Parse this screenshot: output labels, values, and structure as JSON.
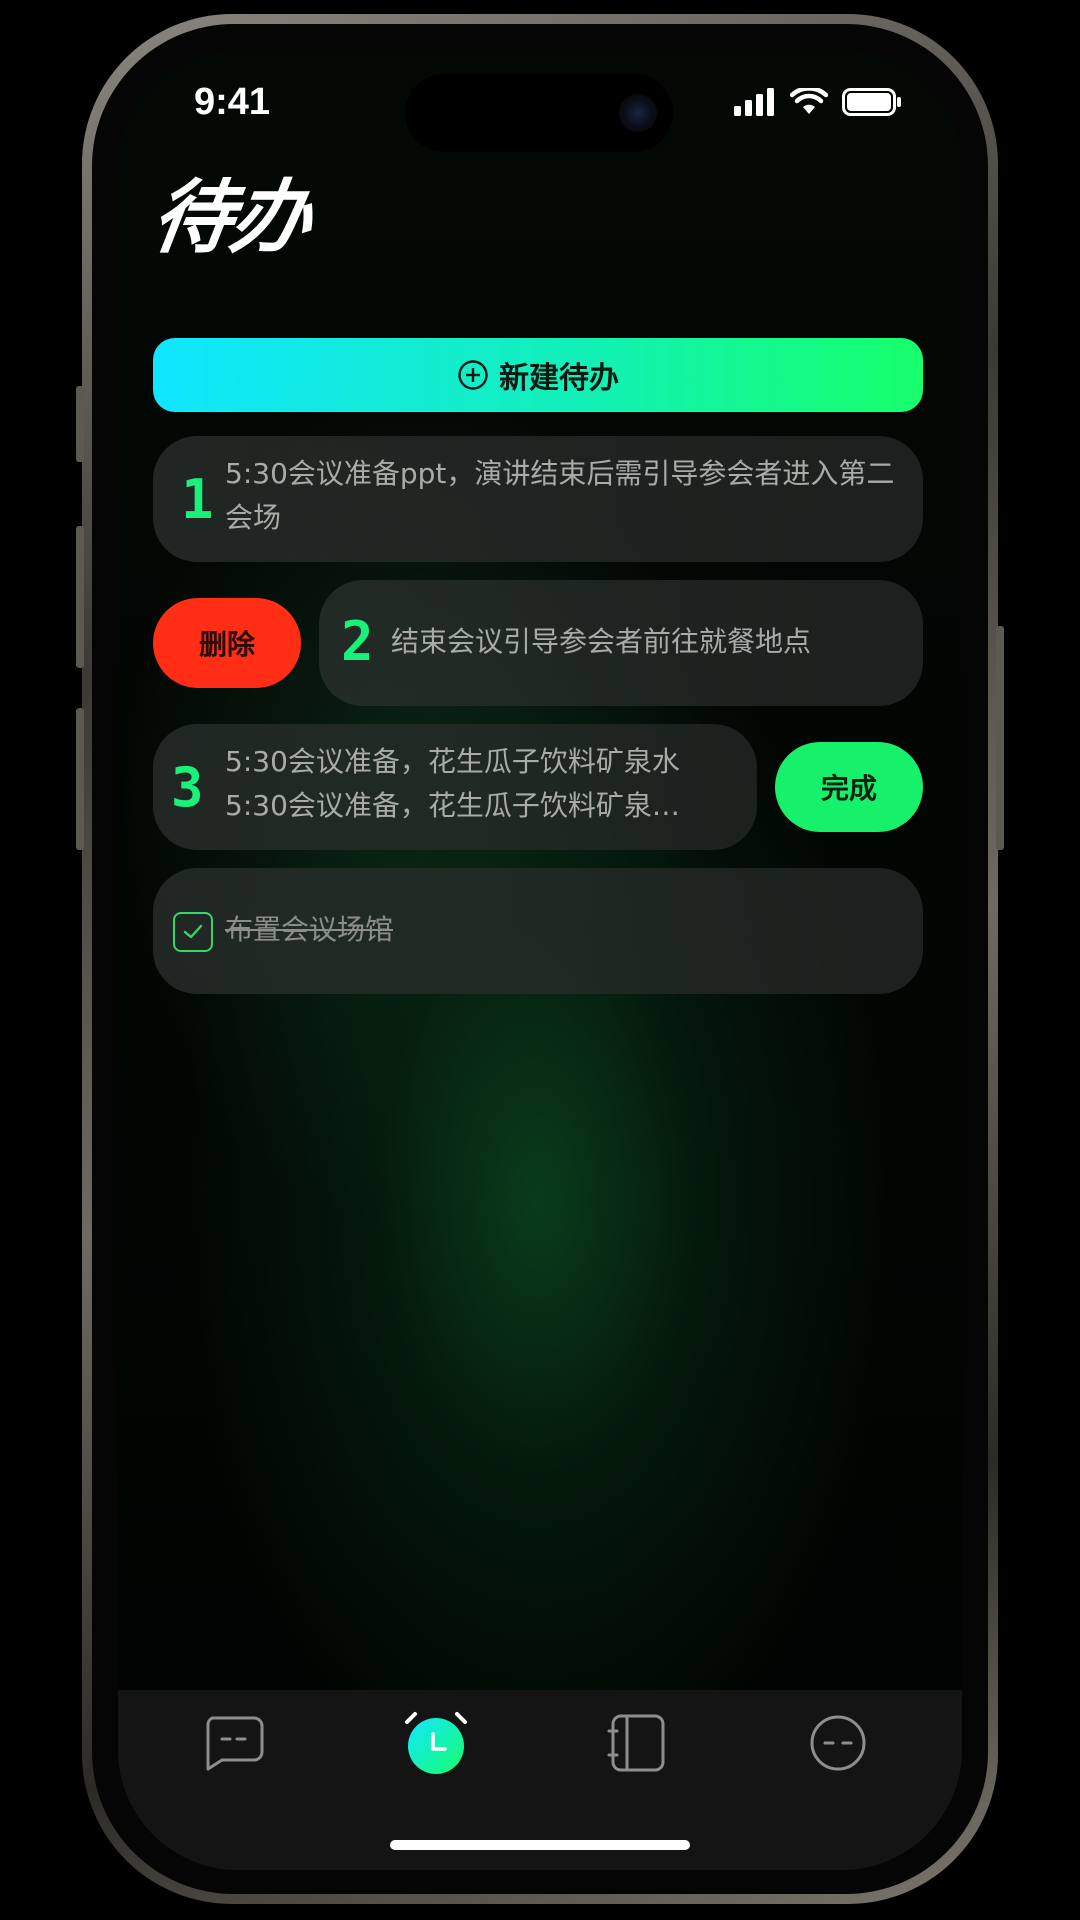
{
  "status_bar": {
    "time": "9:41"
  },
  "header": {
    "title": "待办"
  },
  "actions": {
    "new_todo_label": "新建待办"
  },
  "todos": [
    {
      "number": "1",
      "text": "5:30会议准备ppt，演讲结束后需引导参会者进入第二会场"
    },
    {
      "number": "2",
      "text": "结束会议引导参会者前往就餐地点",
      "swipe_action": "删除"
    },
    {
      "number": "3",
      "line1": "5:30会议准备，花生瓜子饮料矿泉水",
      "line2": "5:30会议准备，花生瓜子饮料矿泉…",
      "swipe_action": "完成"
    },
    {
      "text": "布置会议场馆",
      "completed": true
    }
  ],
  "tabbar": {
    "items": [
      {
        "icon": "chat-bubble-icon",
        "active": false
      },
      {
        "icon": "alarm-clock-icon",
        "active": true
      },
      {
        "icon": "notebook-icon",
        "active": false
      },
      {
        "icon": "face-icon",
        "active": false
      }
    ]
  },
  "colors": {
    "accent_green": "#16f06a",
    "accent_cyan": "#10e6ff",
    "delete_red": "#ff2e14",
    "number_green": "#18f27a"
  }
}
